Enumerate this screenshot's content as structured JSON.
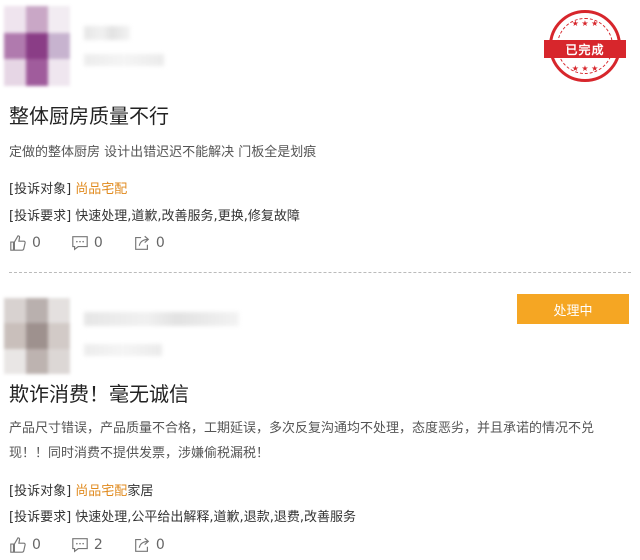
{
  "complaints": [
    {
      "status": "已完成",
      "title": "整体厨房质量不行",
      "description": "定做的整体厨房 设计出错迟迟不能解决 门板全是划痕",
      "target_key": "[投诉对象]",
      "target_value": "尚品宅配",
      "target_suffix": "",
      "request_key": "[投诉要求]",
      "request_value": "快速处理,道歉,改善服务,更换,修复故障",
      "likes": "0",
      "comments": "0",
      "shares": "0"
    },
    {
      "status": "处理中",
      "title": "欺诈消费！毫无诚信",
      "description": "产品尺寸错误，产品质量不合格，工期延误，多次反复沟通均不处理，态度恶劣，并且承诺的情况不兑现！！同时消费不提供发票，涉嫌偷税漏税！",
      "target_key": "[投诉对象]",
      "target_value": "尚品宅配",
      "target_suffix": "家居",
      "request_key": "[投诉要求]",
      "request_value": "快速处理,公平给出解释,道歉,退款,退费,改善服务",
      "likes": "0",
      "comments": "2",
      "shares": "0"
    }
  ],
  "colors": {
    "stamp_red": "#d7262c",
    "badge_orange": "#f5a623",
    "link_orange": "#e08a1e"
  },
  "icons": {
    "like": "thumbs-up-icon",
    "comment": "comment-icon",
    "share": "share-icon"
  }
}
